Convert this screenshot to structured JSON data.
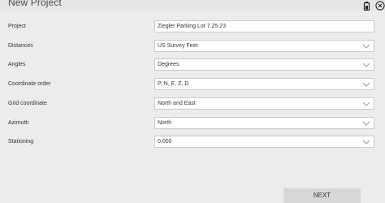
{
  "header": {
    "title": "New Project",
    "icons": [
      "battery-icon",
      "close-icon"
    ]
  },
  "form": {
    "project": {
      "label": "Project",
      "value": "Ziegler Parking Lot 7.25.23"
    },
    "distances": {
      "label": "Distances",
      "value": "US Survey Feet"
    },
    "angles": {
      "label": "Angles",
      "value": "Degrees"
    },
    "coordinate_order": {
      "label": "Coordinate order",
      "value": "P, N, E, Z, D"
    },
    "grid_coordinate": {
      "label": "Grid coordinate",
      "value": "North and East"
    },
    "azimuth": {
      "label": "Azimuth",
      "value": "North"
    },
    "stationing": {
      "label": "Stationing",
      "value": "0.000"
    }
  },
  "footer": {
    "next_label": "NEXT"
  },
  "colors": {
    "background": "#ececec",
    "field_background": "#ffffff",
    "field_border": "#c9c9c9",
    "button_background": "#d7d7d7",
    "text": "#333333"
  }
}
